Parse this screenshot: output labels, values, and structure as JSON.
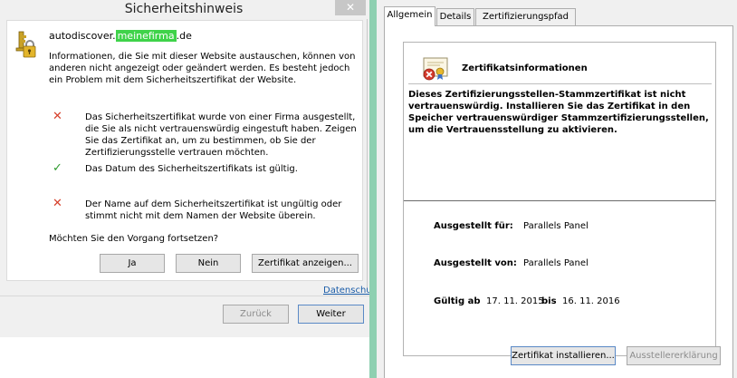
{
  "security_dialog": {
    "title": "Sicherheitshinweis",
    "close_label": "✕",
    "site_prefix": "autodiscover.",
    "site_highlight": "meinefirma",
    "site_suffix": ".de",
    "intro_text": "Informationen, die Sie mit dieser Website austauschen, können von anderen nicht angezeigt oder geändert werden. Es besteht jedoch ein Problem mit dem Sicherheitszertifikat der Website.",
    "items": [
      {
        "status": "error",
        "text": "Das Sicherheitszertifikat wurde von einer Firma ausgestellt, die Sie als nicht vertrauenswürdig eingestuft haben. Zeigen Sie das Zertifikat an, um zu bestimmen, ob Sie der Zertifizierungsstelle vertrauen möchten."
      },
      {
        "status": "ok",
        "text": "Das Datum des Sicherheitszertifikats ist gültig."
      },
      {
        "status": "error",
        "text": "Der Name auf dem Sicherheitszertifikat ist ungültig oder stimmt nicht mit dem Namen der Website überein."
      }
    ],
    "question": "Möchten Sie den Vorgang fortsetzen?",
    "buttons": {
      "yes": "Ja",
      "no": "Nein",
      "view_cert": "Zertifikat anzeigen..."
    }
  },
  "wizard": {
    "privacy_link": "Datenschu",
    "back_label": "Zurück",
    "next_label": "Weiter"
  },
  "certificate_dialog": {
    "tabs": [
      {
        "label": "Allgemein",
        "active": true
      },
      {
        "label": "Details",
        "active": false
      },
      {
        "label": "Zertifizierungspfad",
        "active": false
      }
    ],
    "heading": "Zertifikatsinformationen",
    "message": "Dieses Zertifizierungsstellen-Stammzertifikat ist nicht vertrauenswürdig. Installieren Sie das Zertifikat in den Speicher vertrauenswürdiger Stammzertifizierungsstellen, um die Vertrauensstellung zu aktivieren.",
    "issued_to_label": "Ausgestellt für:",
    "issued_to": "Parallels Panel",
    "issued_by_label": "Ausgestellt von:",
    "issued_by": "Parallels Panel",
    "valid_from_label": "Gültig ab",
    "valid_from": "17. 11. 2015",
    "valid_to_label": "bis",
    "valid_to": "16. 11. 2016",
    "install_label": "Zertifikat installieren...",
    "issuer_statement_label": "Ausstellererklärung"
  },
  "colors": {
    "highlight_green": "#3fd34a",
    "error_red": "#d6402b",
    "ok_green": "#2f9b2f",
    "separator_green": "#8ed0b1",
    "link_blue": "#1a5ca8"
  },
  "icons": {
    "site_icon": "key-lock-icon",
    "cert_icon": "certificate-error-icon",
    "error_mark": "cross-icon",
    "ok_mark": "checkmark-icon"
  }
}
